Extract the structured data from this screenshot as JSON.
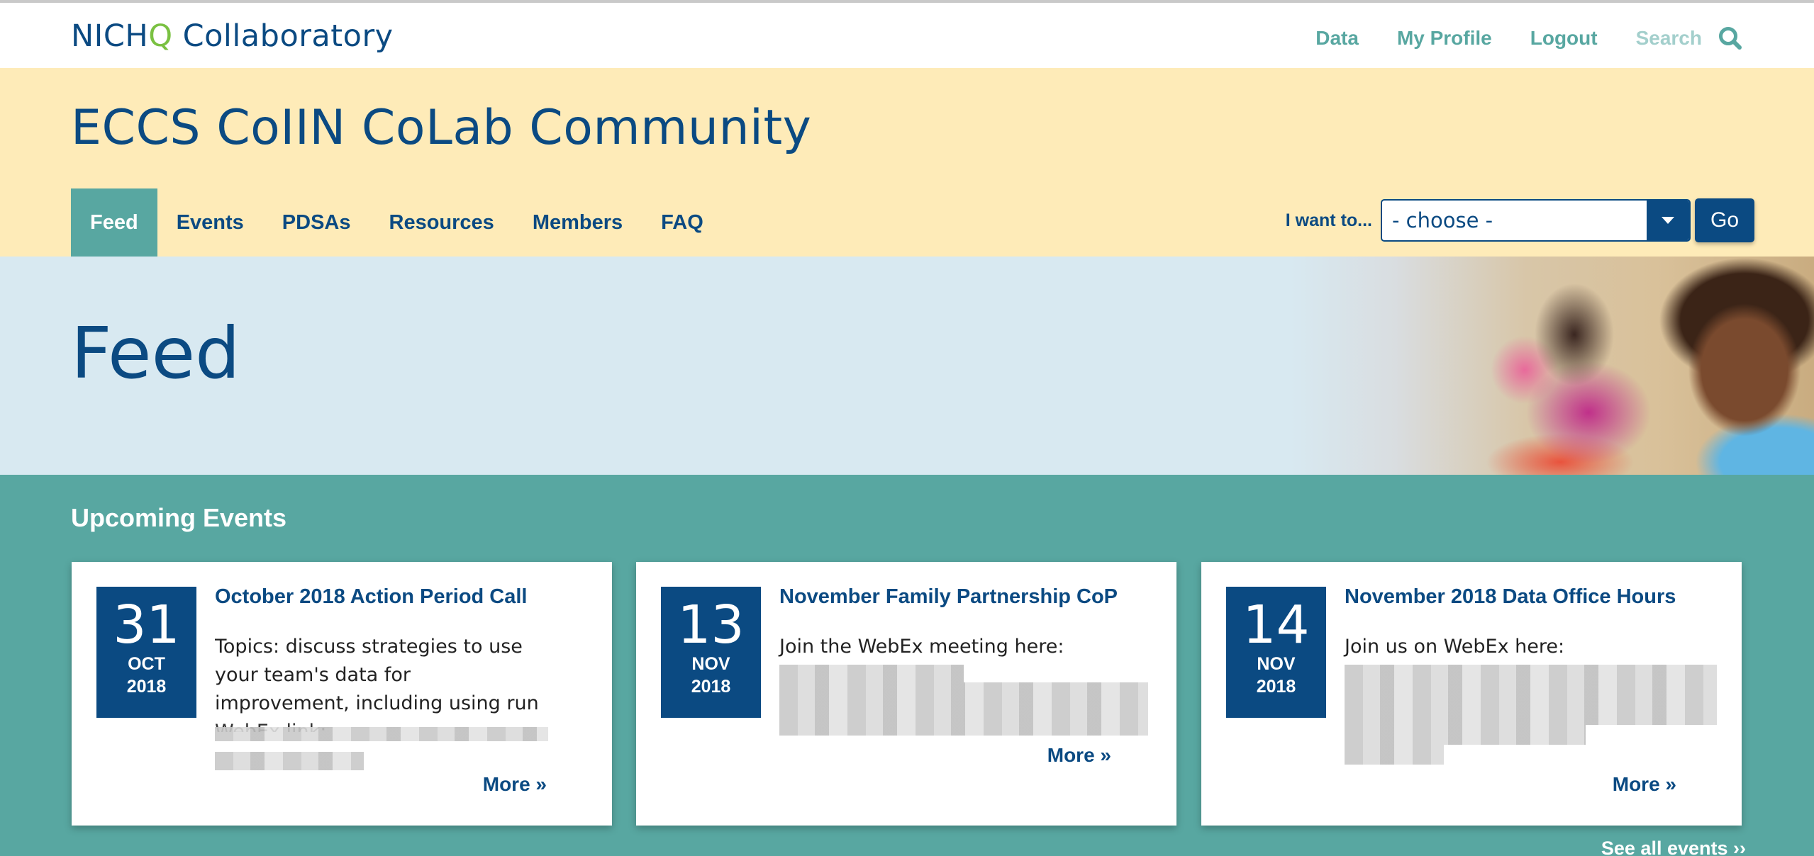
{
  "header": {
    "logo_part1": "NICH",
    "logo_q": "Q",
    "logo_part2": "Collaboratory",
    "nav": [
      {
        "label": "Data"
      },
      {
        "label": "My Profile"
      },
      {
        "label": "Logout"
      }
    ],
    "search_label": "Search",
    "search_icon": "magnifier-icon"
  },
  "community": {
    "title": "ECCS CoIIN CoLab Community",
    "nav": [
      {
        "label": "Feed",
        "active": true
      },
      {
        "label": "Events"
      },
      {
        "label": "PDSAs"
      },
      {
        "label": "Resources"
      },
      {
        "label": "Members"
      },
      {
        "label": "FAQ"
      }
    ],
    "i_want_label": "I want to...",
    "select_value": "- choose -",
    "go_label": "Go"
  },
  "hero": {
    "title": "Feed",
    "image": "smiling-child-classroom-photo"
  },
  "events": {
    "heading": "Upcoming Events",
    "see_all": "See all events ››",
    "items": [
      {
        "day": "31",
        "month": "OCT",
        "year": "2018",
        "title": "October 2018 Action Period Call",
        "desc": "Topics: discuss strategies to use your team's data for improvement, including using run chart rules",
        "desc_cut": "WebEx link: https://nichq.webex.com",
        "more": "More »"
      },
      {
        "day": "13",
        "month": "NOV",
        "year": "2018",
        "title": "November Family Partnership CoP",
        "desc": "Join the WebEx meeting here:",
        "more": "More »"
      },
      {
        "day": "14",
        "month": "NOV",
        "year": "2018",
        "title": "November 2018 Data Office Hours",
        "desc": "Join us on WebEx here:",
        "more": "More »"
      }
    ]
  },
  "colors": {
    "navy": "#0b4a82",
    "teal": "#58a7a1",
    "cream": "#feebb8",
    "hero_blue": "#d8e9f1",
    "logo_green": "#7ac142"
  }
}
